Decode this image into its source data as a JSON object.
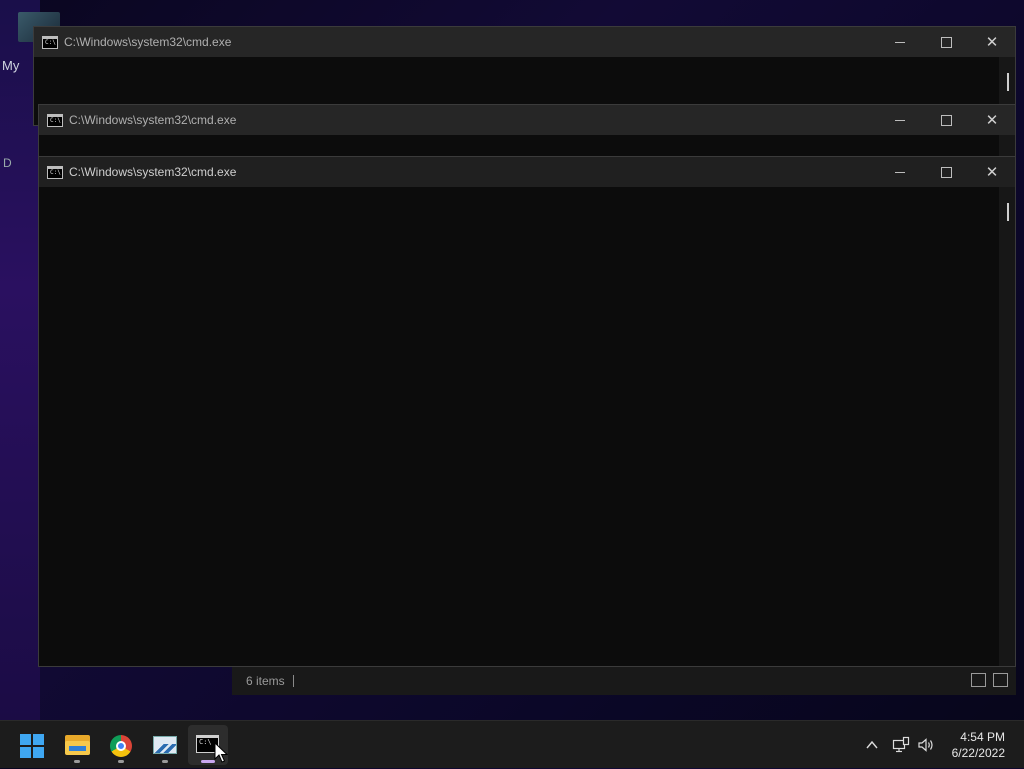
{
  "desktop": {
    "label_my": "My",
    "label_d": "D"
  },
  "explorer": {
    "status_items": "6 items"
  },
  "windows": [
    {
      "title": "C:\\Windows\\system32\\cmd.exe"
    },
    {
      "title": "C:\\Windows\\system32\\cmd.exe"
    },
    {
      "title": "C:\\Windows\\system32\\cmd.exe"
    }
  ],
  "icons": {
    "cmd_glyph": "C:\\",
    "close_glyph": "✕"
  },
  "taskbar": {
    "apps": [
      {
        "name": "start",
        "icon": "windows-logo-icon"
      },
      {
        "name": "file-explorer",
        "icon": "folder-icon"
      },
      {
        "name": "chrome",
        "icon": "chrome-icon"
      },
      {
        "name": "photos",
        "icon": "photo-icon"
      },
      {
        "name": "command-prompt",
        "icon": "cmd-icon",
        "active": true
      }
    ],
    "tray": {
      "chevron": "^",
      "time": "4:54 PM",
      "date": "6/22/2022"
    }
  },
  "colors": {
    "taskbar_bg": "#1c1c1c",
    "window_titlebar": "#202020",
    "console_bg": "#0c0c0c",
    "start_blue": "#3fa7f2",
    "active_indicator": "#c9a7f0"
  }
}
